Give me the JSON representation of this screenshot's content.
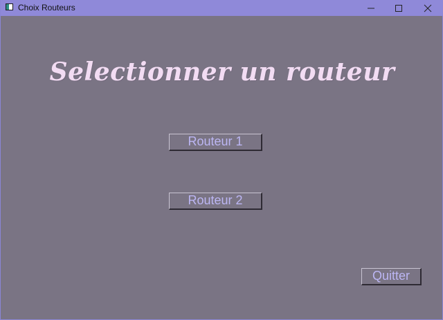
{
  "window": {
    "title": "Choix Routeurs"
  },
  "titlebar_controls": {
    "minimize": "minimize-icon",
    "maximize": "maximize-icon",
    "close": "close-icon"
  },
  "main": {
    "heading": "Selectionner un routeur",
    "buttons": {
      "router1_label": "Routeur 1",
      "router2_label": "Routeur 2",
      "quit_label": "Quitter"
    }
  },
  "colors": {
    "titlebar": "#8f89d9",
    "background": "#7a7484",
    "heading_text": "#f2dcf3",
    "button_text": "#bcb6f4"
  }
}
